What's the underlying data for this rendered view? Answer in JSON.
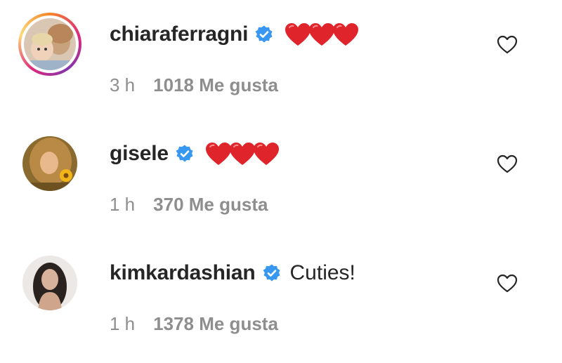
{
  "comments": [
    {
      "username": "chiaraferragni",
      "verified": true,
      "text": "",
      "hearts": 3,
      "time": "3 h",
      "likes": "1018 Me gusta",
      "avatar": "avatar-with-story-ring",
      "icon_like": "heart-outline-icon"
    },
    {
      "username": "gisele",
      "verified": true,
      "text": "",
      "hearts": 3,
      "time": "1 h",
      "likes": "370 Me gusta",
      "avatar": "avatar",
      "icon_like": "heart-outline-icon"
    },
    {
      "username": "kimkardashian",
      "verified": true,
      "text": "Cuties!",
      "hearts": 0,
      "time": "1 h",
      "likes": "1378 Me gusta",
      "avatar": "avatar",
      "icon_like": "heart-outline-icon"
    }
  ],
  "colors": {
    "verified_badge": "#3897f0",
    "heart_red": "#e0242b",
    "meta_gray": "#8e8e8e",
    "text": "#262626"
  }
}
